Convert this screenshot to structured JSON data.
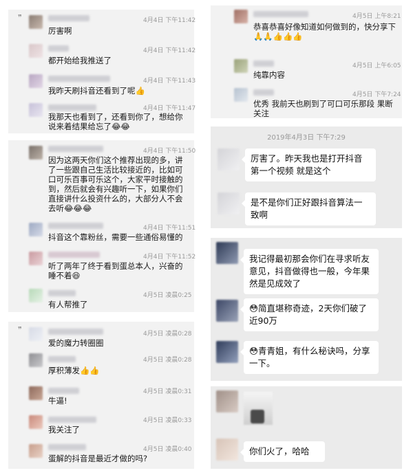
{
  "panel1": {
    "messages": [
      {
        "time": "4月4日 下午11:42",
        "text": "厉害啊"
      },
      {
        "time": "4月4日 下午11:42",
        "text": "都开始给我推送了"
      },
      {
        "time": "4月4日 下午11:43",
        "text": "我昨天刷抖音还看到了呢👍"
      },
      {
        "time": "4月4日 下午11:47",
        "text": "我那天也看到了，还看到你了，想给你说来着结果给忘了😂😂"
      }
    ]
  },
  "panel2": {
    "messages": [
      {
        "time": "4月4日 下午11:50",
        "text": "因为这两天你们这个推荐出现的多，讲了一些跟自己生活比较接近的，比如可口可乐百事可乐这个，大家平时接触的到，然后就会有兴趣听一下，如果你们直接讲什么投资什么的，大部分人不会去听😂😂😂"
      },
      {
        "time": "4月4日 下午11:51",
        "text": "抖音这个靠粉丝，需要一些通俗易懂的"
      },
      {
        "time": "4月4日 下午11:52",
        "text": "听了两年了终于看到蛋总本人，兴奋的睡不着😆"
      },
      {
        "time": "4月5日 凌晨0:25",
        "text": "有人帮推了"
      }
    ]
  },
  "panel3": {
    "messages": [
      {
        "time": "4月5日 凌晨0:28",
        "text": "爱的魔力转圈圈"
      },
      {
        "time": "4月5日 凌晨0:28",
        "text": "厚积薄发👍👍"
      },
      {
        "time": "4月5日 凌晨0:31",
        "text": "牛逼!"
      },
      {
        "time": "4月5日 凌晨0:33",
        "text": "我关注了"
      },
      {
        "time": "4月5日 凌晨0:40",
        "text": "蛋解的抖音是最近才做的吗?"
      }
    ]
  },
  "panel4": {
    "messages": [
      {
        "time": "4月5日 上午8:21",
        "text": "恭喜恭喜好像知道如何做到的，快分享下🙏🙏👍👍👍"
      },
      {
        "time": "4月5日 上午6:05",
        "text": "纯靠内容"
      },
      {
        "time": "4月5日 下午7:24",
        "text": "优秀 我前天也刷到了可口可乐那段 果断关注"
      }
    ]
  },
  "panel5": {
    "stamp": "2019年4月3日 下午7:29",
    "bubbles": [
      "厉害了。昨天我也是打开抖音第一个视频 就是这个",
      "是不是你们正好跟抖音算法一致啊"
    ]
  },
  "panel6": {
    "bubbles": [
      "我记得最初那会你们在寻求听友意见，抖音做得也一般，今年果然是见成效了",
      "😳简直堪称奇迹，2天你们破了近90万",
      "😳青青姐，有什么秘诀吗，分享一下。"
    ]
  },
  "panel7": {
    "bubbles": [
      "你们火了，哈哈"
    ]
  },
  "colors": {
    "panel": "#f2f2f2",
    "panel_right": "#ebebeb",
    "bubble": "#ffffff",
    "time": "#9a9a9a"
  }
}
